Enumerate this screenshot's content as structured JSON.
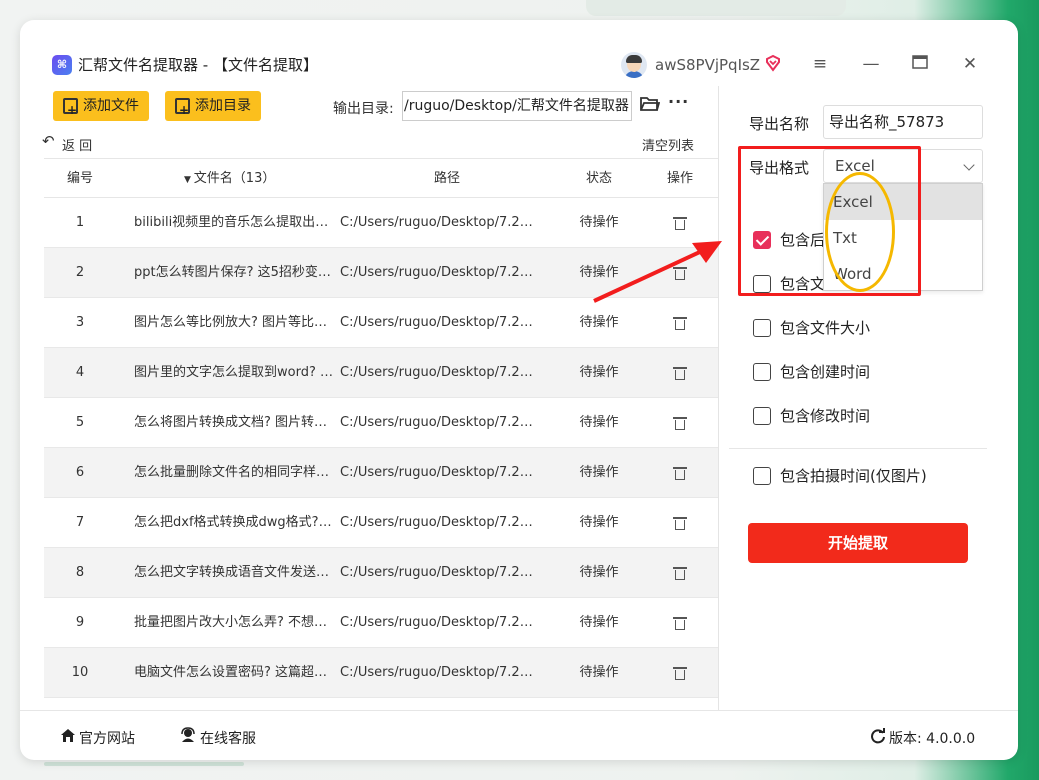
{
  "app": {
    "title": "汇帮文件名提取器 - 【文件名提取】",
    "username": "awS8PVjPqIsZ"
  },
  "toolbar": {
    "add_file": "添加文件",
    "add_folder": "添加目录",
    "output_label": "输出目录:",
    "output_path": "/ruguo/Desktop/汇帮文件名提取器",
    "back": "返  回",
    "clear": "清空列表"
  },
  "table": {
    "headers": {
      "no": "编号",
      "name": "文件名（13）",
      "path": "路径",
      "status": "状态",
      "op": "操作"
    },
    "rows": [
      {
        "no": "1",
        "name": "bilibili视频里的音乐怎么提取出来...",
        "path": "C:/Users/ruguo/Desktop/7.27/b...",
        "status": "待操作"
      },
      {
        "no": "2",
        "name": "ppt怎么转图片保存? 这5招秒变高...",
        "path": "C:/Users/ruguo/Desktop/7.27/p...",
        "status": "待操作"
      },
      {
        "no": "3",
        "name": "图片怎么等比例放大? 图片等比例...",
        "path": "C:/Users/ruguo/Desktop/7.27/...",
        "status": "待操作"
      },
      {
        "no": "4",
        "name": "图片里的文字怎么提取到word? 5...",
        "path": "C:/Users/ruguo/Desktop/7.27/...",
        "status": "待操作"
      },
      {
        "no": "5",
        "name": "怎么将图片转换成文档? 图片转文...",
        "path": "C:/Users/ruguo/Desktop/7.27/...",
        "status": "待操作"
      },
      {
        "no": "6",
        "name": "怎么批量删除文件名的相同字样? ...",
        "path": "C:/Users/ruguo/Desktop/7.27/...",
        "status": "待操作"
      },
      {
        "no": "7",
        "name": "怎么把dxf格式转换成dwg格式? ...",
        "path": "C:/Users/ruguo/Desktop/7.27/...",
        "status": "待操作"
      },
      {
        "no": "8",
        "name": "怎么把文字转换成语音文件发送? ...",
        "path": "C:/Users/ruguo/Desktop/7.27/...",
        "status": "待操作"
      },
      {
        "no": "9",
        "name": "批量把图片改大小怎么弄? 不想一...",
        "path": "C:/Users/ruguo/Desktop/7.27/...",
        "status": "待操作"
      },
      {
        "no": "10",
        "name": "电脑文件怎么设置密码? 这篇超全...",
        "path": "C:/Users/ruguo/Desktop/7.27/...",
        "status": "待操作"
      }
    ]
  },
  "panel": {
    "export_name_label": "导出名称",
    "export_name_value": "导出名称_57873",
    "export_format_label": "导出格式",
    "export_format_value": "Excel",
    "format_options": [
      "Excel",
      "Txt",
      "Word"
    ],
    "opt1_label": "包含后",
    "opt2_label": "包含文",
    "opt3_label": "包含文件大小",
    "opt4_label": "包含创建时间",
    "opt5_label": "包含修改时间",
    "opt6_label": "包含拍摄时间(仅图片)",
    "start_button": "开始提取"
  },
  "statusbar": {
    "website": "官方网站",
    "support": "在线客服",
    "version": "版本:  4.0.0.0"
  },
  "colors": {
    "accent_yellow": "#fbbf1d",
    "start_red": "#f22a1b",
    "checkbox_pink": "#e8305a",
    "annotation_red": "#f21d1d",
    "annotation_yellow": "#f5b800"
  }
}
